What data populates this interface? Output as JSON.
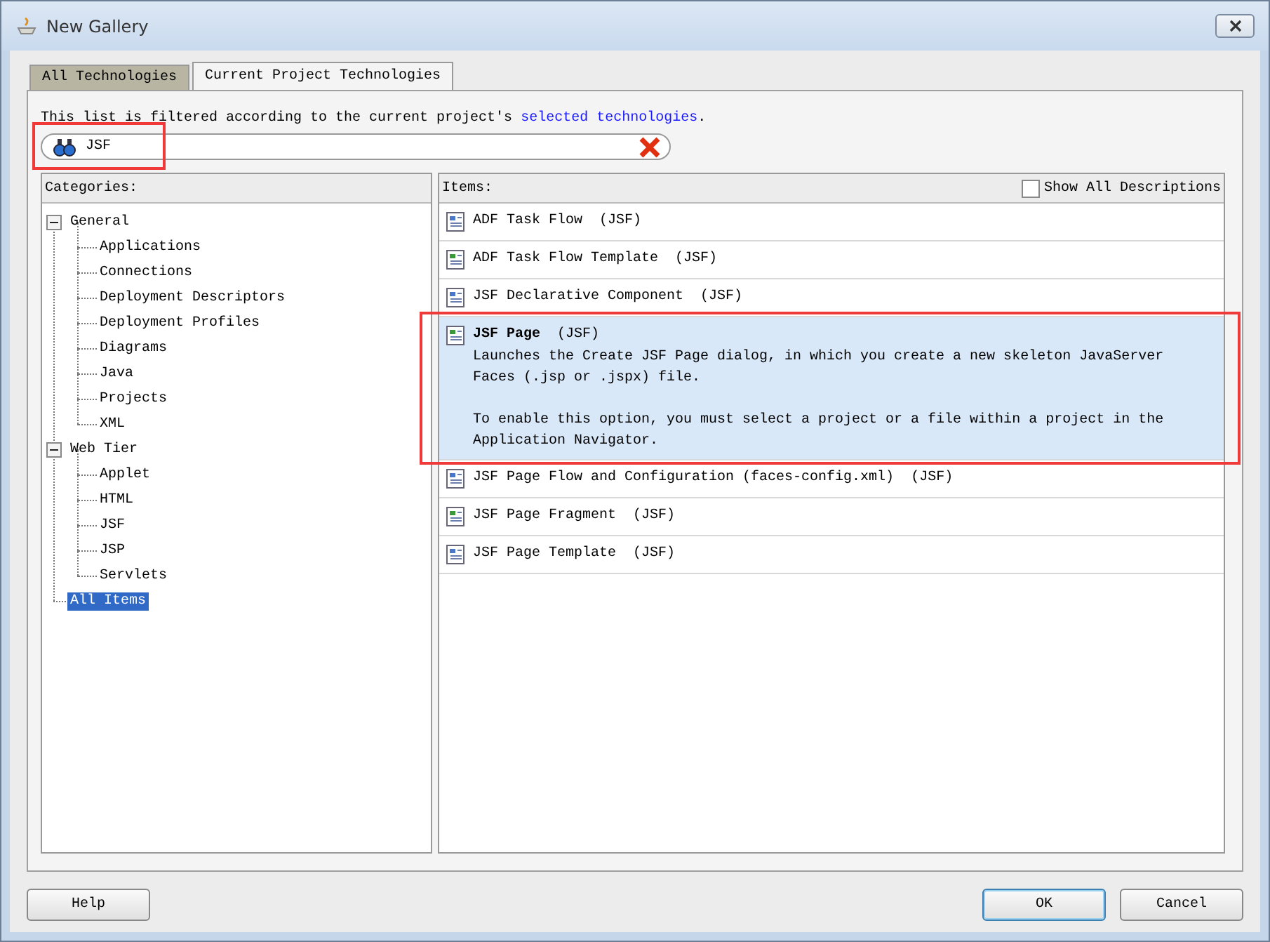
{
  "window": {
    "title": "New Gallery"
  },
  "tabs": [
    {
      "label": "All Technologies",
      "selected": false
    },
    {
      "label": "Current Project Technologies",
      "selected": true
    }
  ],
  "filter_note": {
    "text": "This list is filtered according to the current project's ",
    "link": "selected technologies",
    "after": "."
  },
  "search": {
    "value": "JSF"
  },
  "categories": {
    "heading": "Categories:",
    "items": [
      {
        "label": "General",
        "expanded": true,
        "selected": false,
        "children": [
          {
            "label": "Applications",
            "selected": false
          },
          {
            "label": "Connections",
            "selected": false
          },
          {
            "label": "Deployment Descriptors",
            "selected": false
          },
          {
            "label": "Deployment Profiles",
            "selected": false
          },
          {
            "label": "Diagrams",
            "selected": false
          },
          {
            "label": "Java",
            "selected": false
          },
          {
            "label": "Projects",
            "selected": false
          },
          {
            "label": "XML",
            "selected": false
          }
        ]
      },
      {
        "label": "Web Tier",
        "expanded": true,
        "selected": false,
        "children": [
          {
            "label": "Applet",
            "selected": false
          },
          {
            "label": "HTML",
            "selected": false
          },
          {
            "label": "JSF",
            "selected": false
          },
          {
            "label": "JSP",
            "selected": false
          },
          {
            "label": "Servlets",
            "selected": false
          }
        ]
      },
      {
        "label": "All Items",
        "selected": true
      }
    ]
  },
  "items": {
    "heading": "Items:",
    "show_all_descriptions": {
      "label": "Show All Descriptions",
      "checked": false
    },
    "rows": [
      {
        "name": "ADF Task Flow",
        "tag": "(JSF)",
        "selected": false
      },
      {
        "name": "ADF Task Flow Template",
        "tag": "(JSF)",
        "selected": false
      },
      {
        "name": "JSF Declarative Component",
        "tag": "(JSF)",
        "selected": false
      },
      {
        "name": "JSF Page",
        "tag": "(JSF)",
        "selected": true,
        "description": [
          "Launches the Create JSF Page dialog, in which you create a new skeleton JavaServer Faces (.jsp or .jspx) file.",
          "To enable this option, you must select a project or a file within a project in the Application Navigator."
        ]
      },
      {
        "name": "JSF Page Flow and Configuration (faces-config.xml)",
        "tag": "(JSF)",
        "selected": false
      },
      {
        "name": "JSF Page Fragment",
        "tag": "(JSF)",
        "selected": false
      },
      {
        "name": "JSF Page Template",
        "tag": "(JSF)",
        "selected": false
      }
    ]
  },
  "buttons": {
    "help": "Help",
    "ok": "OK",
    "cancel": "Cancel"
  }
}
